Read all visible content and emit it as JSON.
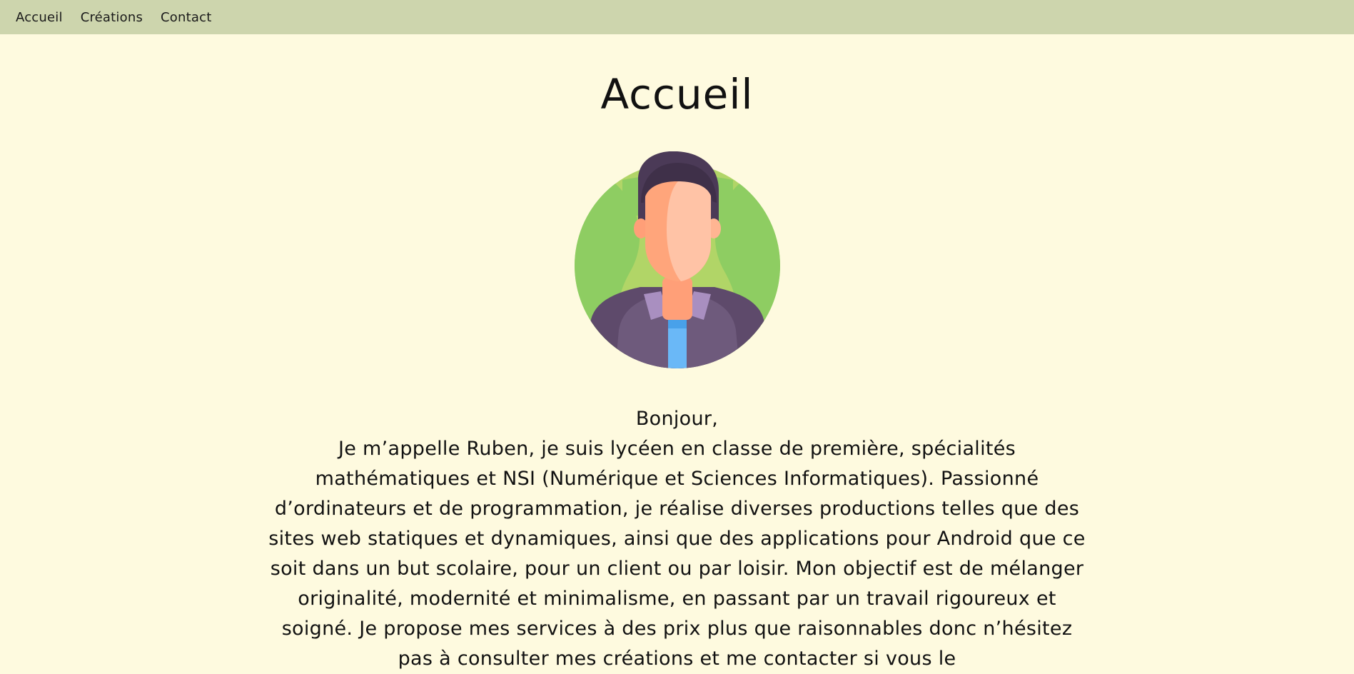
{
  "nav": {
    "items": [
      "Accueil",
      "Créations",
      "Contact"
    ]
  },
  "page": {
    "title": "Accueil"
  },
  "avatar": {
    "icon": "man-avatar-icon"
  },
  "intro": {
    "greeting": "Bonjour,",
    "body": "Je m’appelle Ruben, je suis lycéen en classe de première, spécialités mathématiques et NSI (Numérique et Sciences Informatiques). Passionné d’ordinateurs et de programmation, je réalise diverses productions telles que des sites web statiques et dynamiques, ainsi que des applications pour Android que ce soit dans un but scolaire, pour un client ou par loisir. Mon objectif est de mélanger originalité, modernité et minimalisme, en passant par un travail rigoureux et soigné. Je propose mes services à des prix plus que raisonnables donc n’hésitez pas à consulter mes créations et me contacter si vous le"
  },
  "colors": {
    "navbar": "#cdd5ad",
    "background": "#fefadf"
  }
}
